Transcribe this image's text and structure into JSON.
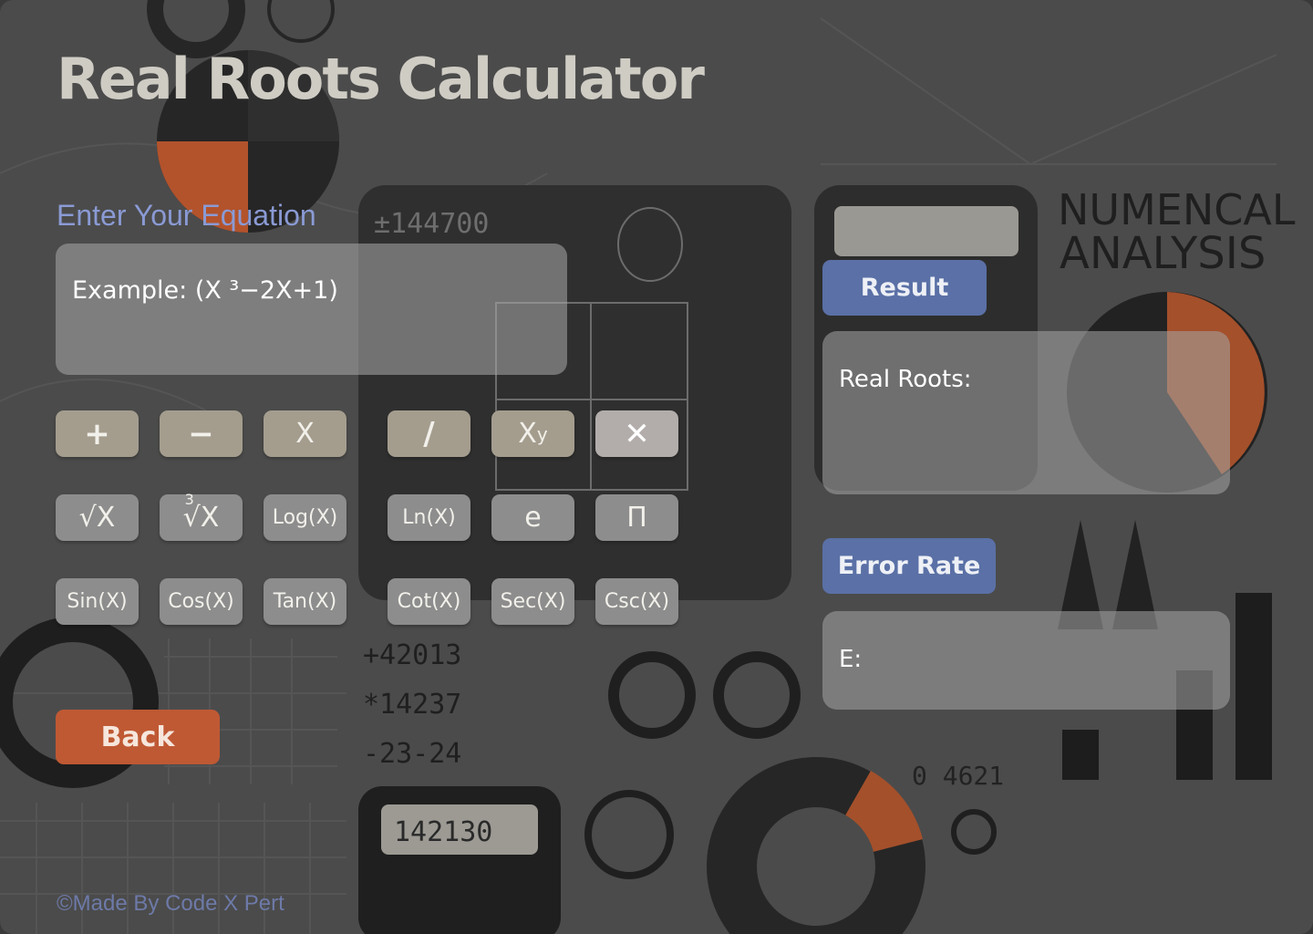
{
  "title": "Real Roots Calculator",
  "input": {
    "label": "Enter Your Equation",
    "placeholder": "Example: (X ³−2X+1)"
  },
  "keys": {
    "plus": "+",
    "minus": "−",
    "x": "X",
    "divide": "/",
    "power_base": "X",
    "power_exp": "y",
    "clear": "✕",
    "sqrt": "√X",
    "cbrt_index": "3",
    "cbrt": "√X",
    "log": "Log(X)",
    "ln": "Ln(X)",
    "e": "e",
    "pi": "Π",
    "sin": "Sin(X)",
    "cos": "Cos(X)",
    "tan": "Tan(X)",
    "cot": "Cot(X)",
    "sec": "Sec(X)",
    "csc": "Csc(X)"
  },
  "result": {
    "button": "Result",
    "roots_label": "Real Roots:"
  },
  "error": {
    "button": "Error Rate",
    "label": "E:"
  },
  "back_label": "Back",
  "footer": "©Made By Code X Pert",
  "background_text": {
    "heading_1": "NUMENCAL",
    "heading_2": "ANALYSIS",
    "calc_display": "142130",
    "num_1": "+42013",
    "num_2": "*14237",
    "num_3": "-23-24",
    "num_4": "±144700",
    "num_5": "0 4621"
  },
  "colors": {
    "title": "#cfccc4",
    "label": "#8a9ad4",
    "button_blue": "#5a70a6",
    "back_orange": "#bf5934",
    "key_tan": "#a49d8e",
    "key_grey": "#8d8d8d"
  }
}
